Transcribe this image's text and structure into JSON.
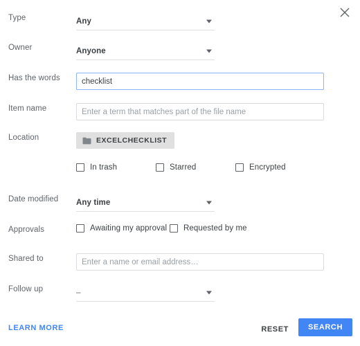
{
  "dialog": {
    "close_icon": "close-icon"
  },
  "fields": {
    "type": {
      "label": "Type",
      "value": "Any"
    },
    "owner": {
      "label": "Owner",
      "value": "Anyone"
    },
    "has_the_words": {
      "label": "Has the words",
      "value": "checklist",
      "placeholder": ""
    },
    "item_name": {
      "label": "Item name",
      "value": "",
      "placeholder": "Enter a term that matches part of the file name"
    },
    "location": {
      "label": "Location",
      "chip_label": "EXCELCHECKLIST",
      "chip_icon": "folder-icon"
    },
    "date_modified": {
      "label": "Date modified",
      "value": "Any time"
    },
    "approvals": {
      "label": "Approvals"
    },
    "shared_to": {
      "label": "Shared to",
      "value": "",
      "placeholder": "Enter a name or email address…"
    },
    "follow_up": {
      "label": "Follow up",
      "value": "–"
    }
  },
  "flags": [
    {
      "label": "In trash",
      "checked": false
    },
    {
      "label": "Starred",
      "checked": false
    },
    {
      "label": "Encrypted",
      "checked": false
    }
  ],
  "approval_options": [
    {
      "label": "Awaiting my approval",
      "checked": false
    },
    {
      "label": "Requested by me",
      "checked": false
    }
  ],
  "footer": {
    "learn_more": "LEARN MORE",
    "reset": "RESET",
    "search": "SEARCH"
  },
  "colors": {
    "accent": "#4285f4",
    "focus_border": "#8ab4f8",
    "chip_background": "#e0e0e0",
    "label_text": "#5f6368",
    "value_text": "#3c4043"
  }
}
